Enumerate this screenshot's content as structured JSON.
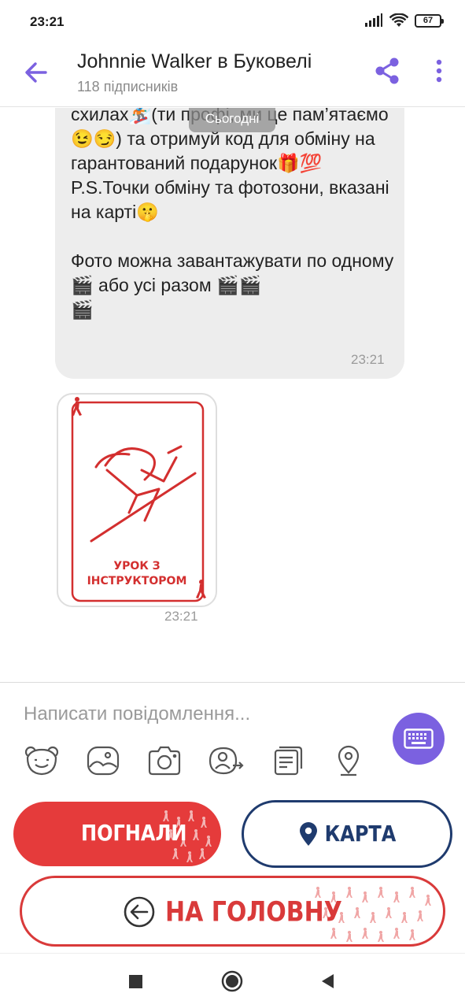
{
  "status_bar": {
    "time": "23:21",
    "battery": "67",
    "icons": [
      "signal-icon",
      "wifi-icon",
      "battery-icon"
    ]
  },
  "header": {
    "title": "Johnnie Walker в Буковелі",
    "subtitle": "118 підписників",
    "icons": [
      "back-arrow-icon",
      "share-icon",
      "more-vert-icon"
    ],
    "accent_color": "#7b61e0"
  },
  "chat": {
    "date_chip": "Сьогодні",
    "message": {
      "text": "схилах🏂(ти профі, ми це пам’ятаємо😉😏) та отримуй код для обміну на гарантований подарунок🎁💯\nP.S.Точки обміну та фотозони, вказані на карті🤫\n\nФото можна завантажувати по одному 🎬 або усі разом 🎬🎬\n🎬",
      "time": "23:21"
    },
    "sticker": {
      "caption_line1": "УРОК З",
      "caption_line2": "ІНСТРУКТОРОМ",
      "time": "23:21",
      "color": "#d32f2f"
    }
  },
  "composer": {
    "placeholder": "Написати повідомлення...",
    "tools": [
      "sticker-bear-icon",
      "gallery-icon",
      "camera-icon",
      "share-contact-icon",
      "notes-icon",
      "location-pin-icon"
    ],
    "keyboard_icon": "keyboard-icon"
  },
  "bot_keyboard": {
    "button1": "ПОГНАЛИ",
    "button2": "КАРТА",
    "button3": "НА ГОЛОВНУ",
    "red": "#e53b3b",
    "navy": "#1f3b6e"
  },
  "nav_bar": {
    "icons": [
      "recents-square-icon",
      "home-circle-icon",
      "back-triangle-icon"
    ]
  }
}
